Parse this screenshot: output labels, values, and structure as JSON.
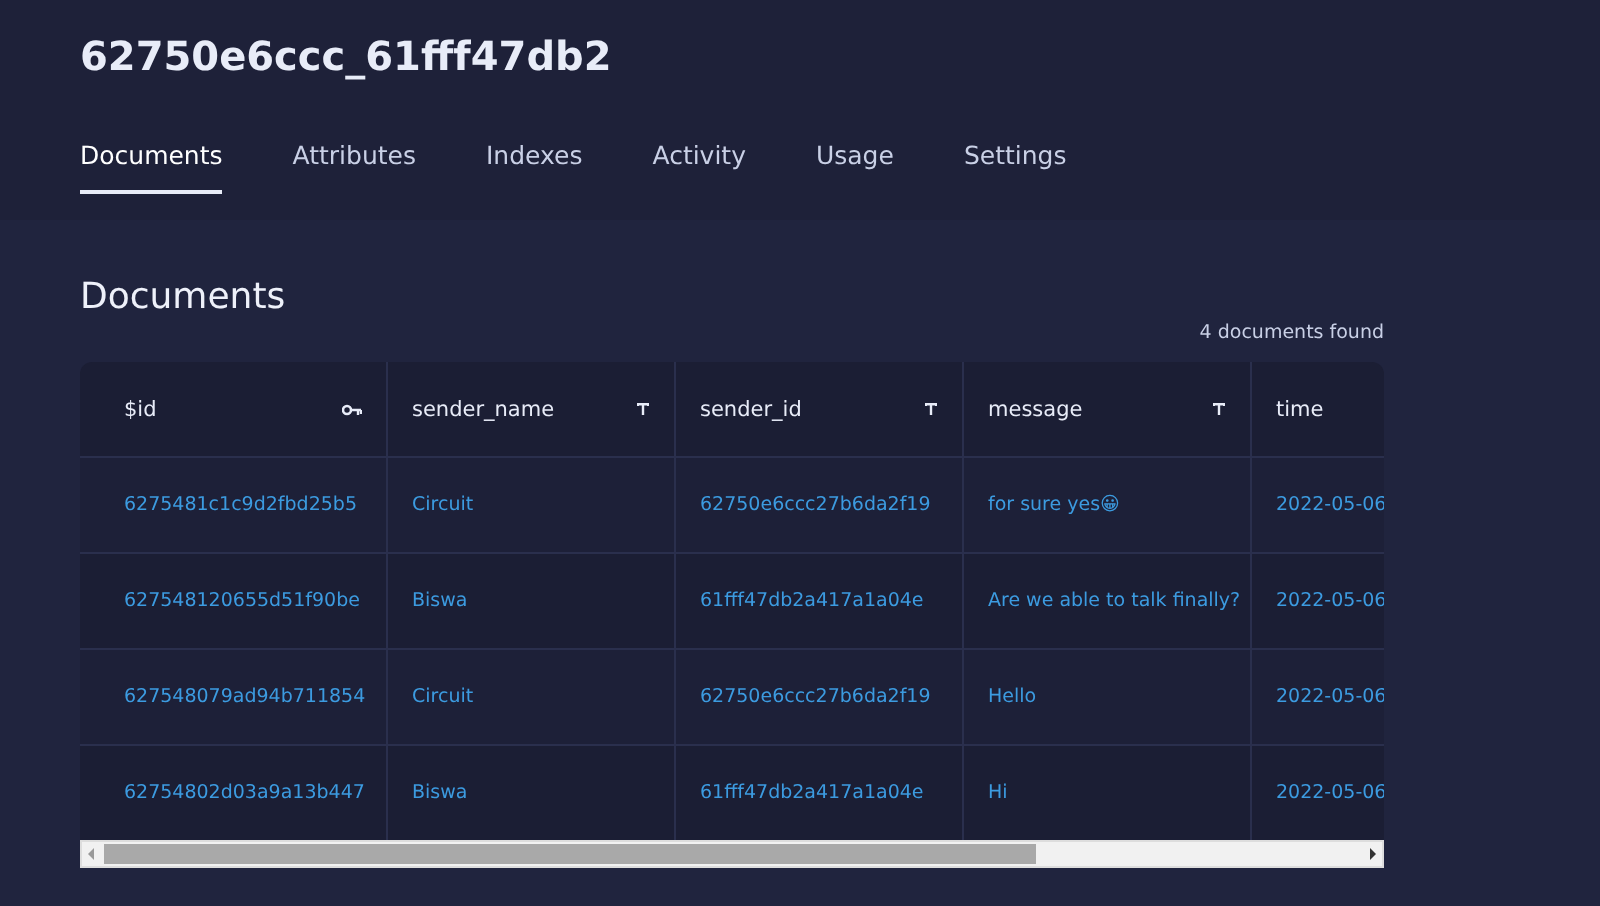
{
  "title": "62750e6ccc_61fff47db2",
  "tabs": [
    {
      "label": "Documents",
      "selected": true
    },
    {
      "label": "Attributes",
      "selected": false
    },
    {
      "label": "Indexes",
      "selected": false
    },
    {
      "label": "Activity",
      "selected": false
    },
    {
      "label": "Usage",
      "selected": false
    },
    {
      "label": "Settings",
      "selected": false
    }
  ],
  "section_title": "Documents",
  "result_count": "4 documents found",
  "table": {
    "columns": [
      {
        "label": "$id",
        "kind": "key"
      },
      {
        "label": "sender_name",
        "kind": "text"
      },
      {
        "label": "sender_id",
        "kind": "text"
      },
      {
        "label": "message",
        "kind": "text"
      },
      {
        "label": "time",
        "kind": "none"
      }
    ],
    "rows": [
      [
        "6275481c1c9d2fbd25b5",
        "Circuit",
        "62750e6ccc27b6da2f19",
        "for sure yes😀",
        "2022-05-06"
      ],
      [
        "627548120655d51f90be",
        "Biswa",
        "61fff47db2a417a1a04e",
        "Are we able to talk finally?",
        "2022-05-06"
      ],
      [
        "627548079ad94b711854",
        "Circuit",
        "62750e6ccc27b6da2f19",
        "Hello",
        "2022-05-06"
      ],
      [
        "62754802d03a9a13b447",
        "Biswa",
        "61fff47db2a417a1a04e",
        "Hi",
        "2022-05-06"
      ]
    ]
  }
}
